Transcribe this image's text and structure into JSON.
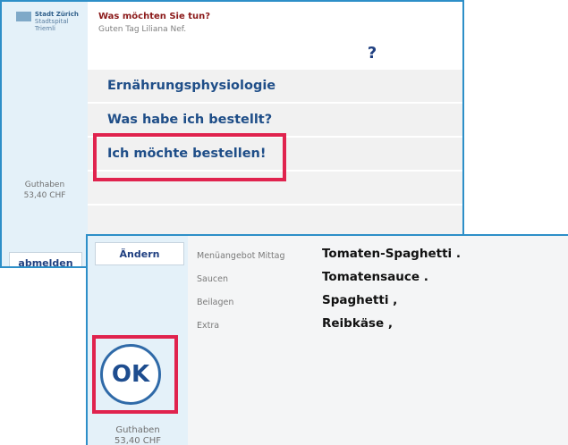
{
  "screen1": {
    "logo": {
      "city": "Stadt Zürich",
      "org": "Stadtspital Triemli"
    },
    "title": "Was möchten Sie tun?",
    "greeting": "Guten Tag Liliana Nef.",
    "help": "?",
    "menu": [
      {
        "label": "Ernährungsphysiologie"
      },
      {
        "label": "Was habe ich bestellt?"
      },
      {
        "label": "Ich möchte bestellen!"
      }
    ],
    "balance": {
      "label": "Guthaben",
      "amount": "53,40 CHF"
    },
    "logout": "abmelden"
  },
  "screen2": {
    "change_button": "Ändern",
    "details": [
      {
        "key": "Menüangebot Mittag",
        "value": "Tomaten-Spaghetti ."
      },
      {
        "key": "Saucen",
        "value": "Tomatensauce ."
      },
      {
        "key": "Beilagen",
        "value": "Spaghetti ,"
      },
      {
        "key": "Extra",
        "value": "Reibkäse ,"
      }
    ],
    "ok_label": "OK",
    "balance": {
      "label": "Guthaben",
      "amount": "53,40 CHF"
    }
  },
  "colors": {
    "frame": "#2d8fc8",
    "highlight": "#e0234e",
    "menu_text": "#1f4e88",
    "title": "#8b1a1a"
  }
}
